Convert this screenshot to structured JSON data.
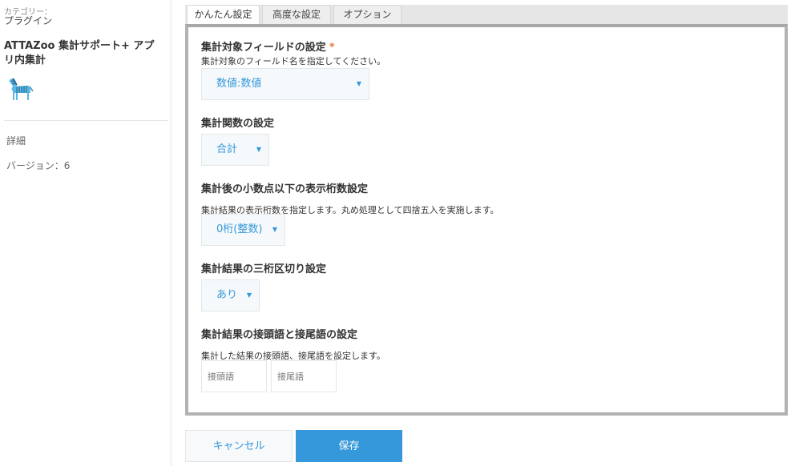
{
  "sidebar": {
    "category_label": "カテゴリー：",
    "category_value": "プラグイン",
    "plugin_name": "ATTAZoo 集計サポート+ アプリ内集計",
    "icon": "zebra-icon",
    "detail_link": "詳細",
    "version": "バージョン：6"
  },
  "tabs": [
    {
      "label": "かんたん設定",
      "active": true
    },
    {
      "label": "高度な設定",
      "active": false
    },
    {
      "label": "オプション",
      "active": false
    }
  ],
  "sections": {
    "field": {
      "title": "集計対象フィールドの設定",
      "required_mark": "*",
      "desc": "集計対象のフィールド名を指定してください。",
      "selected": "数値:数値"
    },
    "function": {
      "title": "集計関数の設定",
      "selected": "合計"
    },
    "decimal": {
      "title": "集計後の小数点以下の表示桁数設定",
      "desc": "集計結果の表示桁数を指定します。丸め処理として四捨五入を実施します。",
      "selected": "0桁(整数)"
    },
    "separator": {
      "title": "集計結果の三桁区切り設定",
      "selected": "あり"
    },
    "affix": {
      "title": "集計結果の接頭語と接尾語の設定",
      "desc": "集計した結果の接頭語、接尾語を設定します。",
      "prefix_placeholder": "接頭語",
      "suffix_placeholder": "接尾語"
    }
  },
  "caret": "▼",
  "buttons": {
    "cancel": "キャンセル",
    "save": "保存"
  },
  "colors": {
    "accent": "#3498db",
    "required": "#e07b39",
    "panel_border": "#b2b2b2"
  }
}
